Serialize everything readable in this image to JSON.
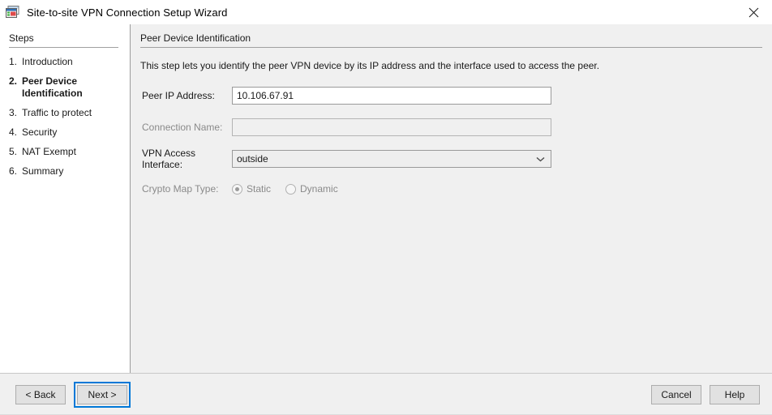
{
  "window": {
    "title": "Site-to-site VPN Connection Setup Wizard",
    "icon": "vpn-wizard-icon",
    "close_label": "close-icon",
    "accent_color": "#0078d7"
  },
  "sidebar": {
    "heading": "Steps",
    "items": [
      {
        "num": "1.",
        "label": "Introduction",
        "active": false
      },
      {
        "num": "2.",
        "label": "Peer Device Identification",
        "active": true
      },
      {
        "num": "3.",
        "label": "Traffic to protect",
        "active": false
      },
      {
        "num": "4.",
        "label": "Security",
        "active": false
      },
      {
        "num": "5.",
        "label": "NAT Exempt",
        "active": false
      },
      {
        "num": "6.",
        "label": "Summary",
        "active": false
      }
    ]
  },
  "main": {
    "section_title": "Peer Device Identification",
    "description": "This step lets you identify the peer VPN device by its IP address and the interface used to access the peer.",
    "fields": {
      "peer_ip": {
        "label": "Peer IP Address:",
        "value": "10.106.67.91",
        "placeholder": ""
      },
      "connection_name": {
        "label": "Connection Name:",
        "value": "",
        "placeholder": ""
      },
      "vpn_access_interface": {
        "label": "VPN Access Interface:",
        "value": "outside",
        "options": [
          "outside"
        ]
      },
      "crypto_map_type": {
        "label": "Crypto Map Type:",
        "selected": "Static",
        "options": [
          "Static",
          "Dynamic"
        ]
      }
    }
  },
  "footer": {
    "back_label": "< Back",
    "next_label": "Next >",
    "cancel_label": "Cancel",
    "help_label": "Help"
  }
}
